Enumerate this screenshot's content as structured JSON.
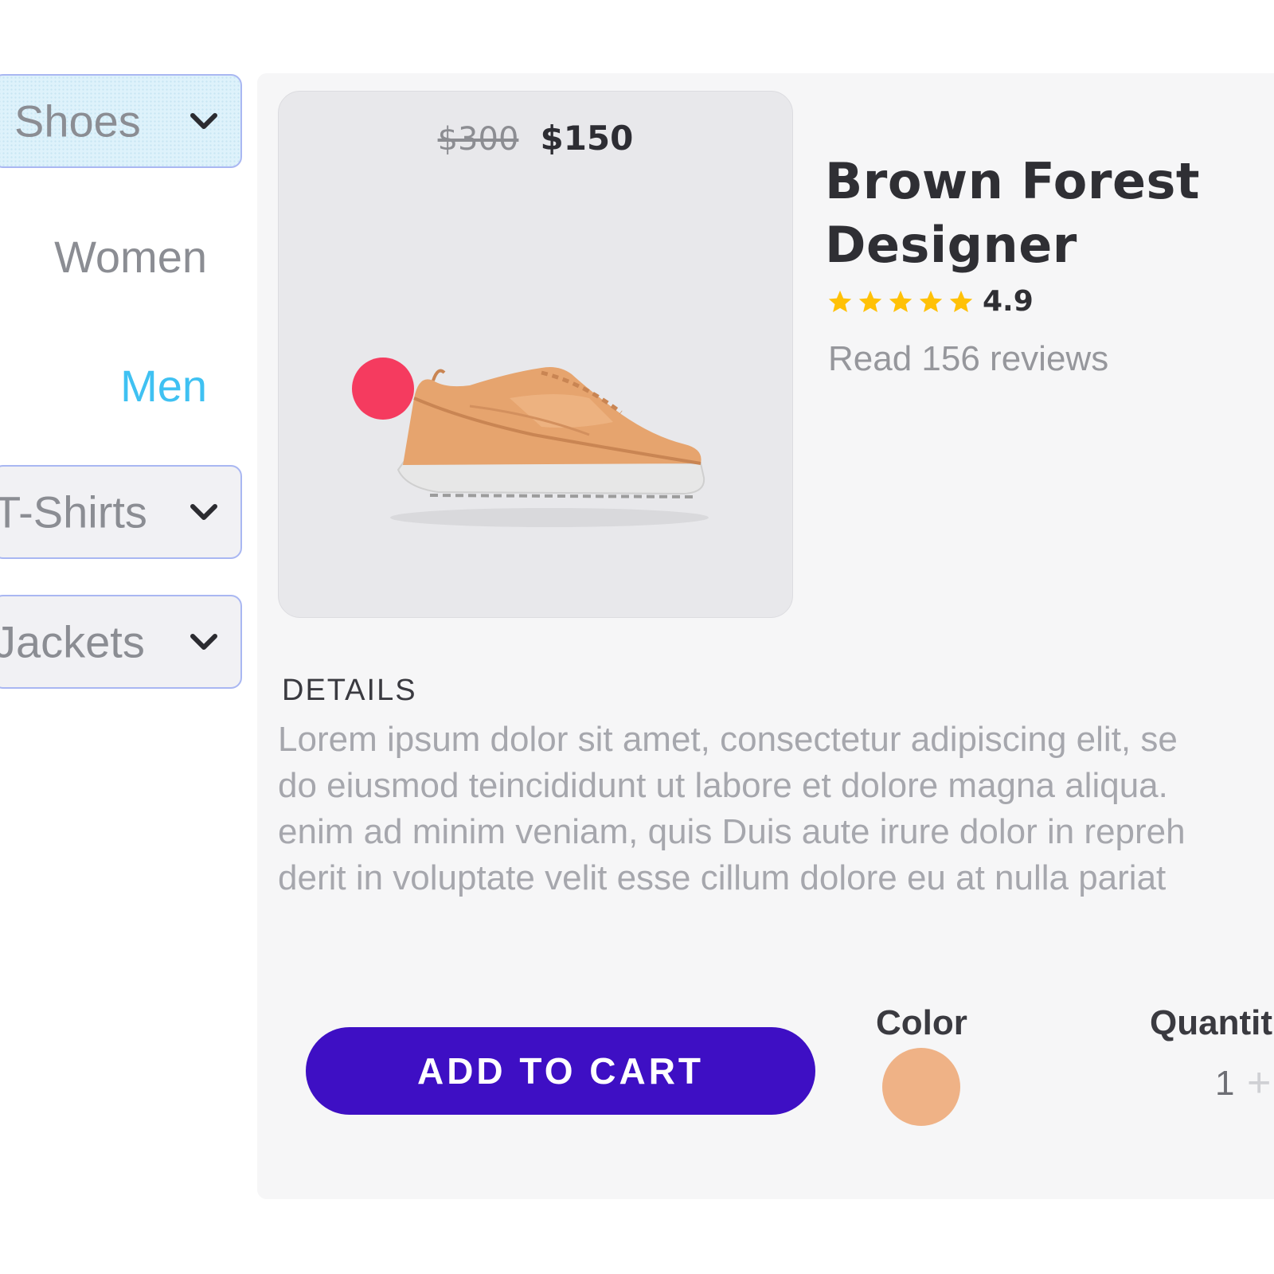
{
  "sidebar": {
    "categories": [
      {
        "label": "Shoes",
        "icon": "chevron-down-icon",
        "active": true
      },
      {
        "label": "T-Shirts",
        "icon": "chevron-down-icon",
        "active": false
      },
      {
        "label": "Jackets",
        "icon": "chevron-down-icon",
        "active": false
      }
    ],
    "subcategories": [
      {
        "label": "Women",
        "selected": false
      },
      {
        "label": "Men",
        "selected": true
      }
    ],
    "colors": {
      "accent": "#3fc1f2",
      "muted": "#8b8d93"
    }
  },
  "product": {
    "old_price": "$300",
    "price": "$150",
    "name": "Brown Forest Designer",
    "rating_value": "4.9",
    "rating_stars": 5,
    "reviews_link": "Read 156 reviews",
    "image_icon": "sneaker-image",
    "badge_color": "#f53b5f"
  },
  "details": {
    "heading": "DETAILS",
    "lines": [
      "Lorem ipsum dolor sit amet, consectetur adipiscing elit, se",
      "do eiusmod teincididunt ut labore et dolore magna aliqua.",
      "enim ad minim veniam, quis Duis aute irure dolor in repreh",
      "derit in voluptate velit esse cillum dolore eu at nulla pariat"
    ]
  },
  "actions": {
    "add_to_cart": "ADD TO CART",
    "button_color": "#3e0fc4",
    "color_label": "Color",
    "selected_color": "#efb286",
    "quantity_label": "Quantit",
    "quantity_value": "1",
    "plus_icon": "plus-icon"
  }
}
